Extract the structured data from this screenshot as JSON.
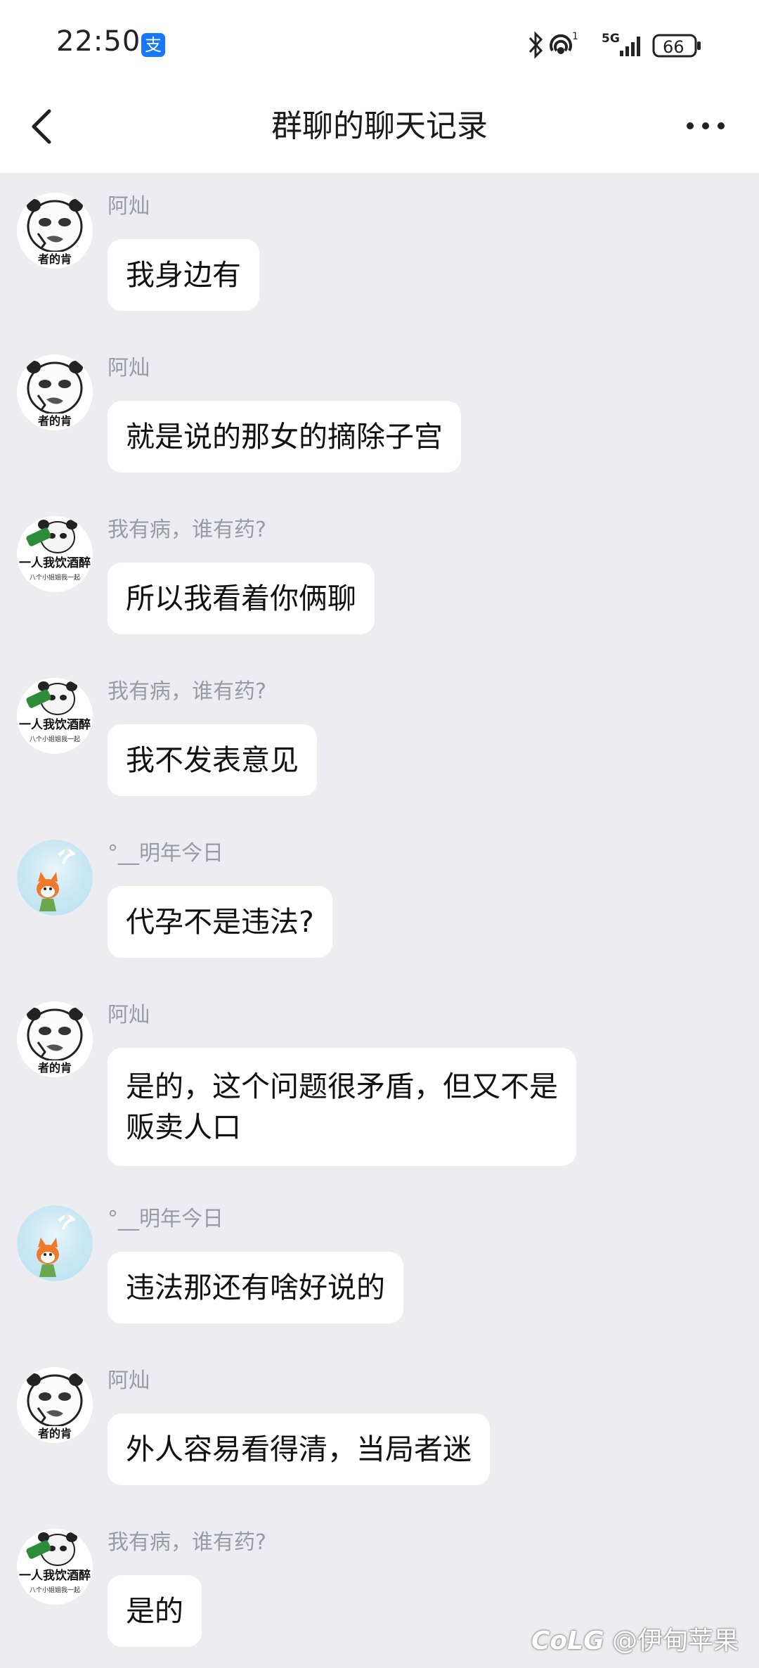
{
  "status_bar": {
    "time": "22:50",
    "app_badge": "支",
    "network": "5G",
    "sim": "1",
    "battery": "66"
  },
  "nav": {
    "title": "群聊的聊天记录"
  },
  "messages": [
    {
      "sender": "阿灿",
      "avatar": "panda-meme-avatar",
      "text": "我身边有"
    },
    {
      "sender": "阿灿",
      "avatar": "panda-meme-avatar",
      "text": "就是说的那女的摘除子宫"
    },
    {
      "sender": "我有病，谁有药?",
      "avatar": "drinking-panda-avatar",
      "avatar_caption": "一人我饮酒醉",
      "text": "所以我看着你俩聊"
    },
    {
      "sender": "我有病，谁有药?",
      "avatar": "drinking-panda-avatar",
      "avatar_caption": "一人我饮酒醉",
      "text": "我不发表意见"
    },
    {
      "sender": "°__明年今日",
      "avatar": "fox-girl-avatar",
      "text": "代孕不是违法?"
    },
    {
      "sender": "阿灿",
      "avatar": "panda-meme-avatar",
      "text": "是的，这个问题很矛盾，但又不是\n贩卖人口"
    },
    {
      "sender": "°__明年今日",
      "avatar": "fox-girl-avatar",
      "text": "违法那还有啥好说的"
    },
    {
      "sender": "阿灿",
      "avatar": "panda-meme-avatar",
      "text": "外人容易看得清，当局者迷"
    },
    {
      "sender": "我有病，谁有药?",
      "avatar": "drinking-panda-avatar",
      "avatar_caption": "一人我饮酒醉",
      "text": "是的"
    }
  ],
  "watermark": "@伊甸苹果",
  "watermark_logo": "CoLG"
}
